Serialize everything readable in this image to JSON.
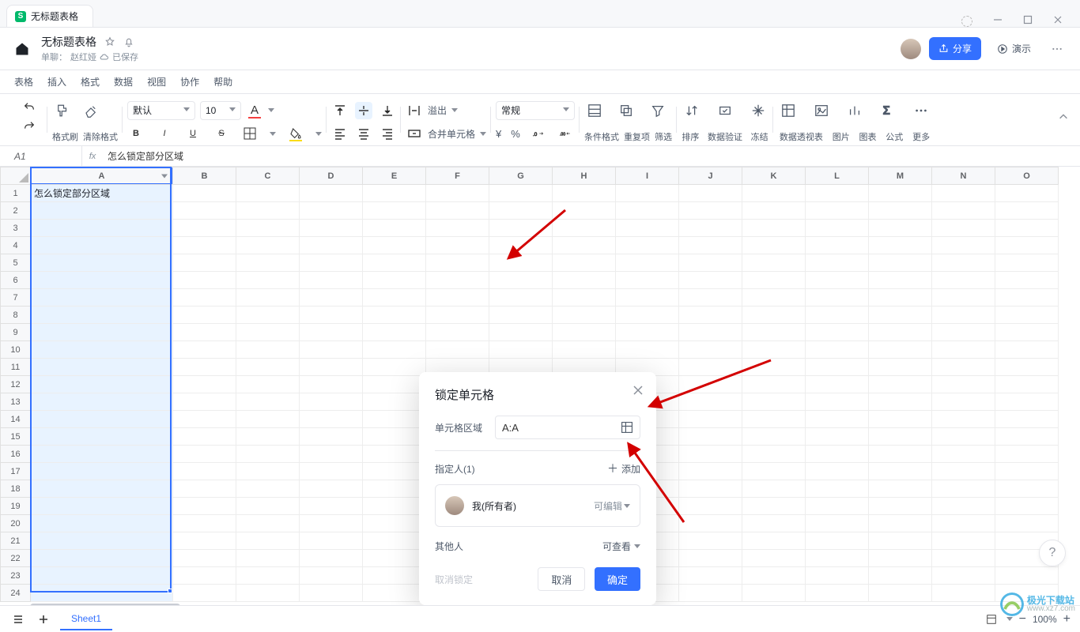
{
  "tab_title": "无标题表格",
  "doc": {
    "title": "无标题表格",
    "subtitle_prefix": "单聊：",
    "subtitle_name": "赵红娅",
    "saved": "已保存"
  },
  "header": {
    "share": "分享",
    "present": "演示"
  },
  "menu": [
    "表格",
    "插入",
    "格式",
    "数据",
    "视图",
    "协作",
    "帮助"
  ],
  "toolbar": {
    "format_painter": "格式刷",
    "clear_format": "清除格式",
    "font_name": "默认",
    "font_size": "10",
    "wrap_overflow": "溢出",
    "merge_cells": "合并单元格",
    "number_format": "常规",
    "cond_format": "条件格式",
    "repeat": "重复项",
    "filter": "筛选",
    "sort": "排序",
    "validation": "数据验证",
    "freeze": "冻结",
    "pivot": "数据透视表",
    "image": "图片",
    "chart": "图表",
    "formula": "公式",
    "more": "更多"
  },
  "formula_bar": {
    "ref": "A1",
    "fx": "fx",
    "value": "怎么锁定部分区域"
  },
  "columns": [
    "A",
    "B",
    "C",
    "D",
    "E",
    "F",
    "G",
    "H",
    "I",
    "J",
    "K",
    "L",
    "M",
    "N",
    "O"
  ],
  "row_count": 24,
  "cell_A1": "怎么锁定部分区域",
  "dialog": {
    "title": "锁定单元格",
    "range_label": "单元格区域",
    "range_value": "A:A",
    "assignee_label": "指定人(1)",
    "add": "添加",
    "user_name": "我(所有者)",
    "user_perm": "可编辑",
    "others_label": "其他人",
    "others_perm": "可查看",
    "unlock": "取消锁定",
    "cancel": "取消",
    "ok": "确定"
  },
  "sheet_tab": "Sheet1",
  "zoom": "100%",
  "watermark_text": "极光下载站",
  "watermark_url": "www.xz7.com"
}
